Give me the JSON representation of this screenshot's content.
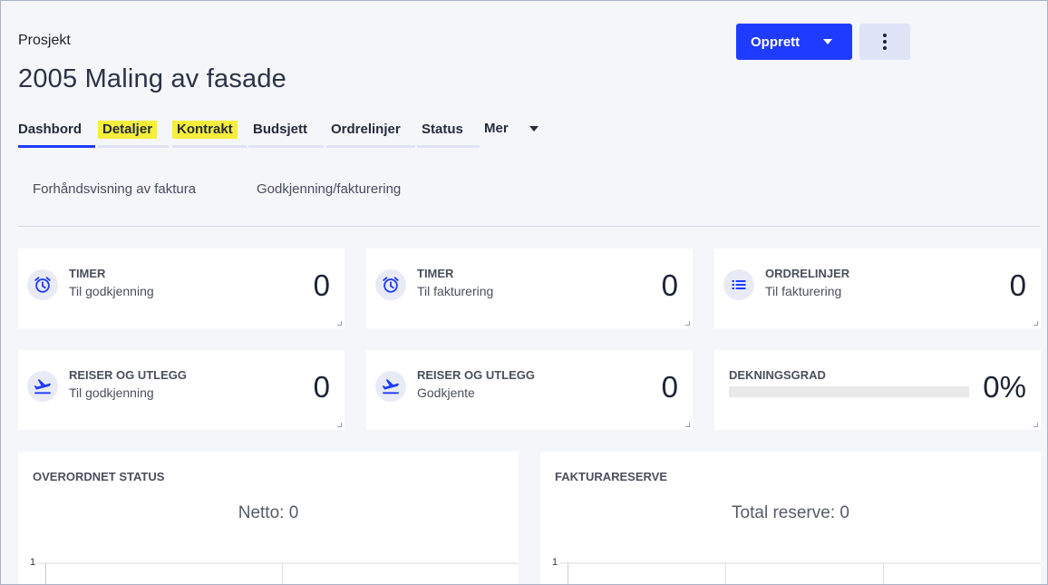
{
  "header": {
    "breadcrumb": "Prosjekt",
    "title": "2005 Maling av fasade",
    "create_label": "Opprett"
  },
  "tabs": [
    {
      "label": "Dashbord",
      "active": true
    },
    {
      "label": "Detaljer",
      "highlighted": true
    },
    {
      "label": "Kontrakt",
      "highlighted": true
    },
    {
      "label": "Budsjett"
    },
    {
      "label": "Ordrelinjer"
    },
    {
      "label": "Status"
    }
  ],
  "more_tab_label": "Mer",
  "sublinks": [
    "Forhåndsvisning av faktura",
    "Godkjenning/fakturering"
  ],
  "cards": [
    {
      "icon": "alarm-clock-icon",
      "title": "TIMER",
      "subtitle": "Til godkjenning",
      "value": "0"
    },
    {
      "icon": "alarm-clock-icon",
      "title": "TIMER",
      "subtitle": "Til fakturering",
      "value": "0"
    },
    {
      "icon": "list-icon",
      "title": "ORDRELINJER",
      "subtitle": "Til fakturering",
      "value": "0"
    },
    {
      "icon": "flight-takeoff-icon",
      "title": "REISER OG UTLEGG",
      "subtitle": "Til godkjenning",
      "value": "0"
    },
    {
      "icon": "flight-takeoff-icon",
      "title": "REISER OG UTLEGG",
      "subtitle": "Godkjente",
      "value": "0"
    },
    {
      "title": "DEKNINGSGRAD",
      "value": "0%",
      "progress": 0
    }
  ],
  "panels": [
    {
      "title": "OVERORDNET STATUS",
      "metric": "Netto: 0",
      "y_tick": "1"
    },
    {
      "title": "FAKTURARESERVE",
      "metric": "Total reserve: 0",
      "y_tick": "1"
    }
  ],
  "colors": {
    "accent": "#1f3bff",
    "highlight": "#f5ef3b",
    "background": "#f5f6fa"
  }
}
